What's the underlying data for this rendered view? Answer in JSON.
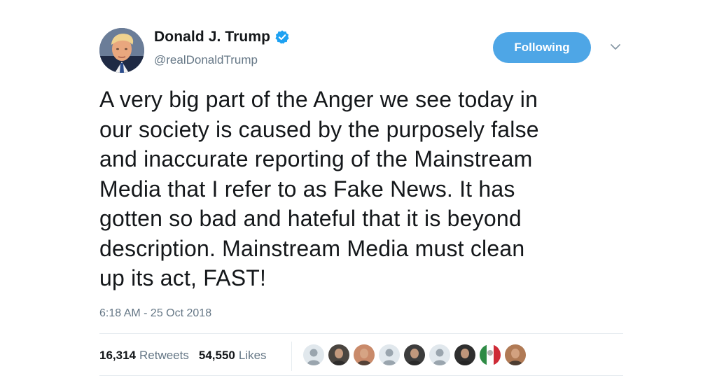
{
  "author": {
    "display_name": "Donald J. Trump",
    "handle": "@realDonaldTrump",
    "verified": true,
    "avatar_icon": "profile-photo"
  },
  "follow_button": {
    "label": "Following"
  },
  "menu": {
    "icon": "chevron-down-icon"
  },
  "tweet": {
    "text": "A very big part of the Anger we see today in\nour society is caused by the purposely false\nand inaccurate reporting of the Mainstream\nMedia that I refer to as Fake News. It has\ngotten so bad and hateful that it is beyond\ndescription. Mainstream Media must clean\nup its act, FAST!",
    "timestamp": "6:18 AM - 25 Oct 2018"
  },
  "stats": {
    "retweets_count": "16,314",
    "retweets_label": "Retweets",
    "likes_count": "54,550",
    "likes_label": "Likes"
  },
  "likers": [
    {
      "type": "default-avatar",
      "color": "#9aa5ae"
    },
    {
      "type": "photo",
      "color": "#4a4540"
    },
    {
      "type": "photo",
      "color": "#c98a6a"
    },
    {
      "type": "default-avatar",
      "color": "#9aa5ae"
    },
    {
      "type": "photo",
      "color": "#3c3c3c"
    },
    {
      "type": "default-avatar",
      "color": "#9aa5ae"
    },
    {
      "type": "photo",
      "color": "#2e2e2e"
    },
    {
      "type": "italy-flag",
      "color": "#2e8b45"
    },
    {
      "type": "photo",
      "color": "#b07a55"
    }
  ],
  "colors": {
    "accent": "#4ea6e6",
    "verified": "#1da1f2",
    "secondary_text": "#657786"
  }
}
